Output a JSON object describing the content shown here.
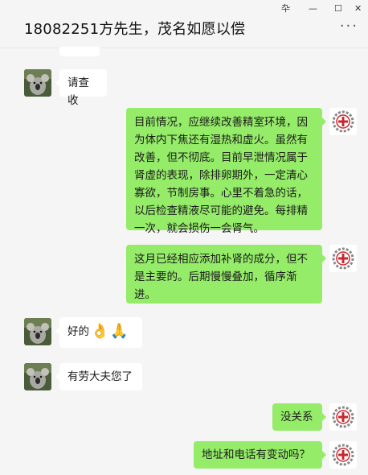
{
  "window": {
    "title": "18082251方先生，茂名如愿以偿",
    "pin_glyph": "卆",
    "minimize_glyph": "—",
    "maximize_glyph": "☐",
    "close_glyph": "✕",
    "more_glyph": "···"
  },
  "messages": [
    {
      "side": "left",
      "text": "请查收"
    },
    {
      "side": "right",
      "text": "目前情况，应继续改善精室环境，因为体内下焦还有湿热和虚火。虽然有改善，但不彻底。目前早泄情况属于肾虚的表现，除排卵期外，一定清心寡欲，节制房事。心里不着急的话，以后检查精液尽可能的避免。每排精一次，就会损伤一会肾气。"
    },
    {
      "side": "right",
      "text": "这月已经相应添加补肾的成分，但不是主要的。后期慢慢叠加，循序渐进。"
    },
    {
      "side": "left",
      "text": "好的",
      "emojis": [
        "👌",
        "🙏"
      ]
    },
    {
      "side": "left",
      "text": "有劳大夫您了"
    },
    {
      "side": "right",
      "text": "没关系"
    },
    {
      "side": "right",
      "text": "地址和电话有变动吗？"
    }
  ],
  "avatars": {
    "left": "koala-avatar-icon",
    "right": "clinic-logo-avatar-icon"
  },
  "colors": {
    "background": "#f5f5f5",
    "bubble_self": "#95ec69",
    "bubble_other": "#ffffff",
    "logo_red": "#c8282d"
  }
}
